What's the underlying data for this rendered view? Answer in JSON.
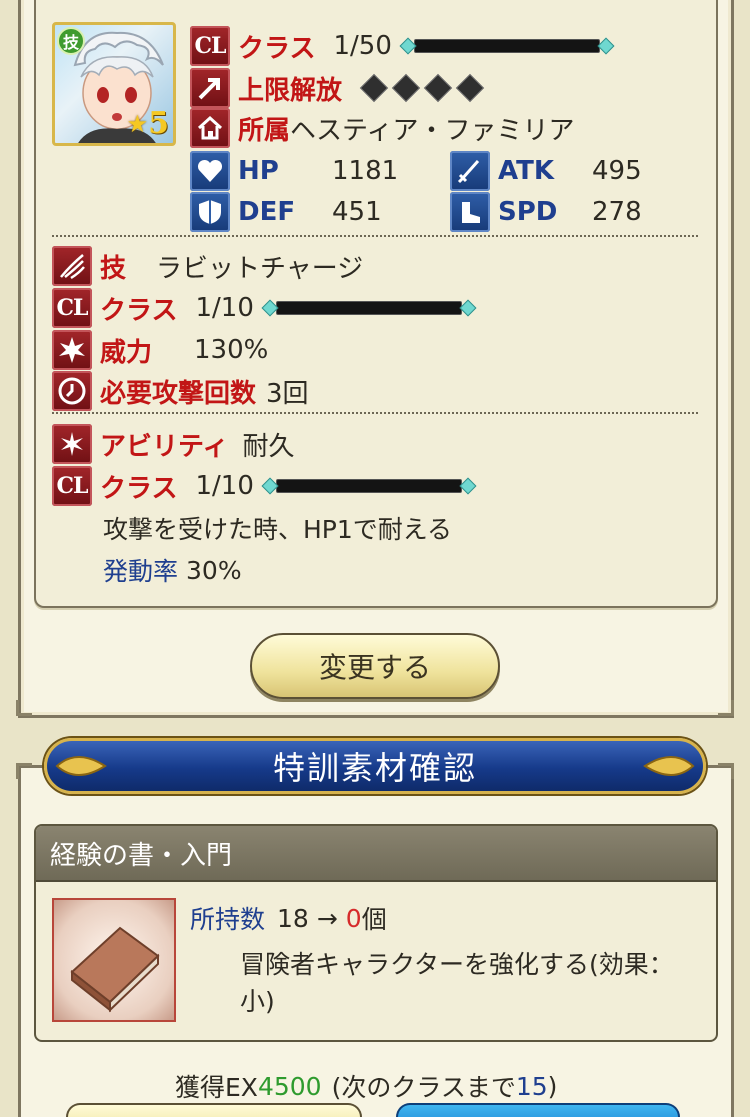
{
  "character": {
    "skill_badge": "技",
    "stars": "5",
    "cl_icon": "CL",
    "class_label": "クラス",
    "class_value": "1/50",
    "limit_break_label": "上限解放",
    "affiliation_label": "所属",
    "affiliation_value": "ヘスティア・ファミリア",
    "hp_label": "HP",
    "hp_value": "1181",
    "atk_label": "ATK",
    "atk_value": "495",
    "def_label": "DEF",
    "def_value": "451",
    "spd_label": "SPD",
    "spd_value": "278"
  },
  "skill": {
    "label": "技",
    "name": "ラビットチャージ",
    "cl_icon": "CL",
    "class_label": "クラス",
    "class_value": "1/10",
    "power_label": "威力",
    "power_value": "130%",
    "attacks_label": "必要攻撃回数",
    "attacks_value": "3回"
  },
  "ability": {
    "label": "アビリティ",
    "name": "耐久",
    "cl_icon": "CL",
    "class_label": "クラス",
    "class_value": "1/10",
    "description": "攻撃を受けた時、HP1で耐える",
    "rate_label": "発動率",
    "rate_value": "30%"
  },
  "change_button": "変更する",
  "section_title": "特訓素材確認",
  "material": {
    "name": "経験の書・入門",
    "owned_label": "所持数",
    "owned_from": "18",
    "arrow": "→",
    "owned_to": "0",
    "unit": "個",
    "description_line1": "冒険者キャラクターを強化する(効果：",
    "description_line2": "小)"
  },
  "exp": {
    "label": "獲得EX",
    "value": "4500",
    "next_prefix": "(次のクラスまで",
    "next_value": "15",
    "next_suffix": ")"
  },
  "colors": {
    "red_label": "#c21616",
    "blue_label": "#1f3f8f",
    "green_value": "#2e9b2e",
    "owned_zero": "#d62b2b"
  }
}
